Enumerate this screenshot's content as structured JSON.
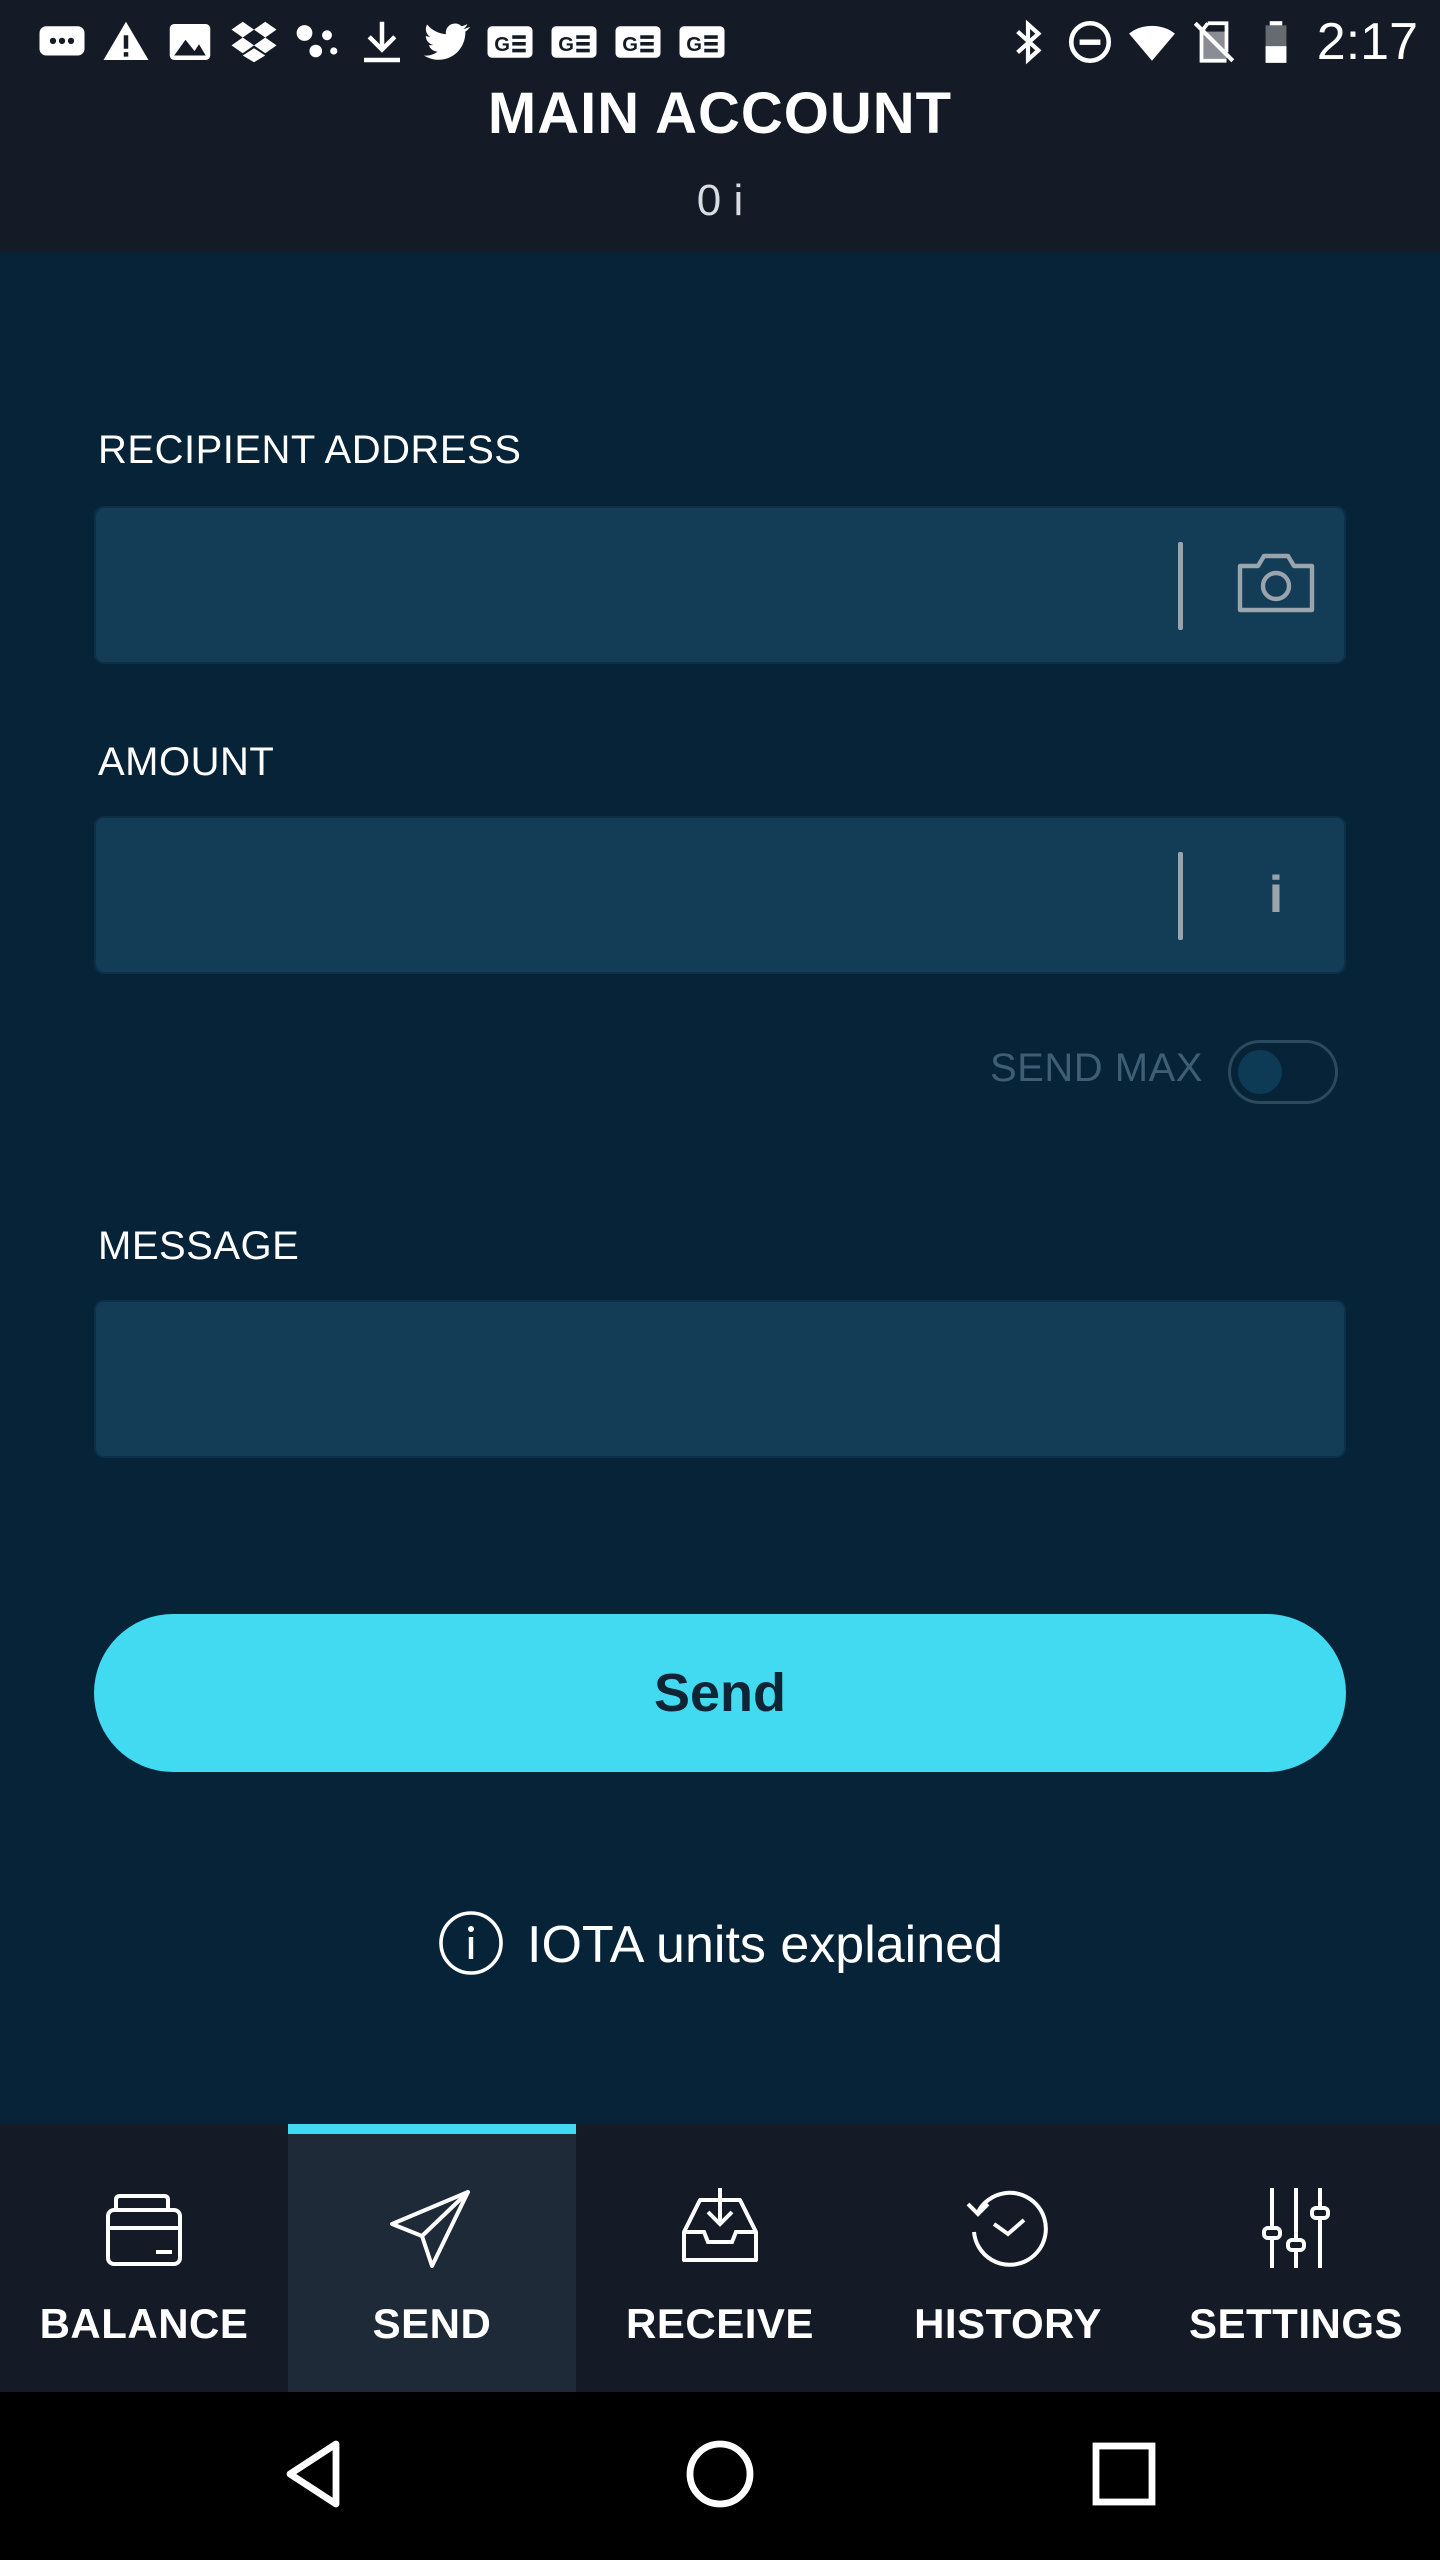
{
  "status_bar": {
    "time": "2:17",
    "left_icons": [
      "messages-icon",
      "warning-icon",
      "image-icon",
      "dropbox-icon",
      "network-dots-icon",
      "download-icon",
      "twitter-icon",
      "google-news-icon",
      "google-news-icon",
      "google-news-icon",
      "google-news-icon"
    ],
    "right_icons": [
      "bluetooth-icon",
      "do-not-disturb-icon",
      "wifi-icon",
      "no-sim-icon",
      "battery-icon"
    ]
  },
  "header": {
    "account_name": "MAIN ACCOUNT",
    "balance": "0 i"
  },
  "form": {
    "recipient_label": "RECIPIENT ADDRESS",
    "recipient_value": "",
    "amount_label": "AMOUNT",
    "amount_value": "",
    "amount_unit": "i",
    "send_max_label": "SEND MAX",
    "send_max_enabled": false,
    "message_label": "MESSAGE",
    "message_value": ""
  },
  "send_button": {
    "label": "Send"
  },
  "units_link": {
    "label": "IOTA units explained"
  },
  "nav": {
    "active": "SEND",
    "items": [
      {
        "label": "BALANCE",
        "icon": "wallet-icon"
      },
      {
        "label": "SEND",
        "icon": "paper-plane-icon"
      },
      {
        "label": "RECEIVE",
        "icon": "inbox-download-icon"
      },
      {
        "label": "HISTORY",
        "icon": "history-clock-icon"
      },
      {
        "label": "SETTINGS",
        "icon": "sliders-icon"
      }
    ]
  },
  "colors": {
    "background": "#062338",
    "header": "#151b26",
    "field": "#133c57",
    "accent": "#41daf0",
    "muted": "#3f5e73"
  }
}
